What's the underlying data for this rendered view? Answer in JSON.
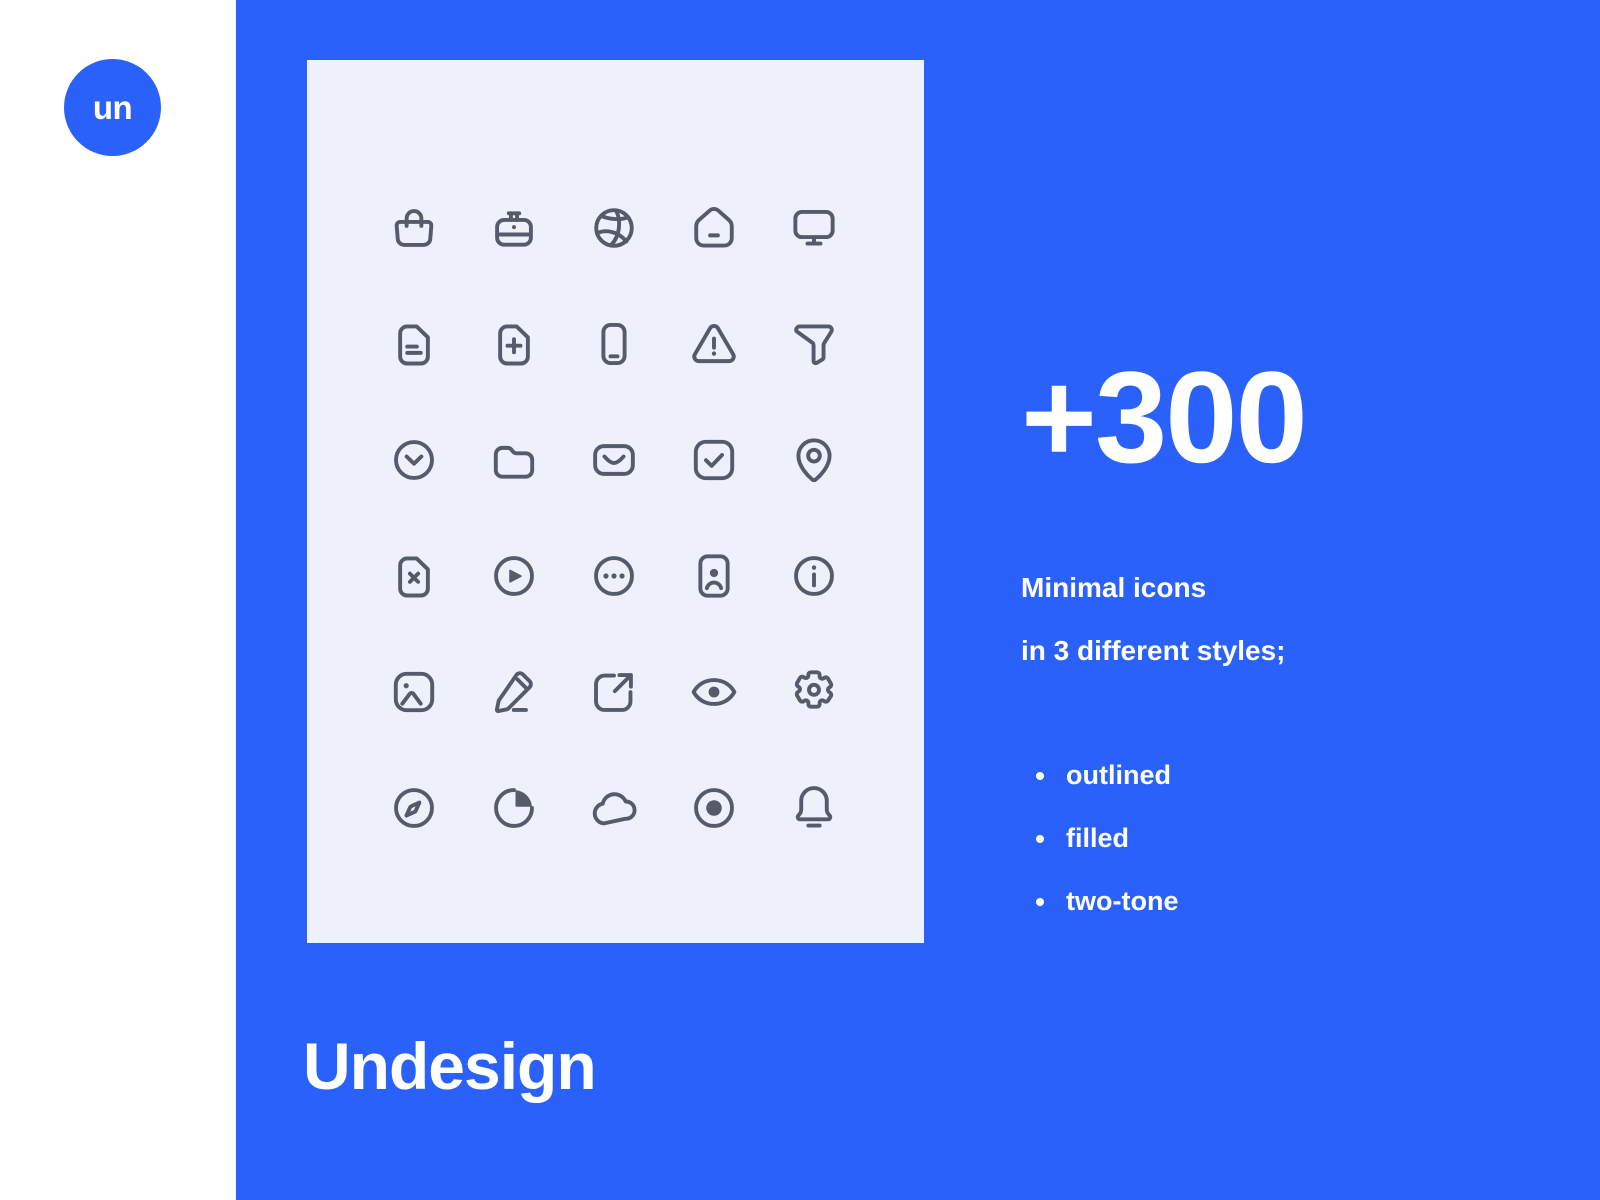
{
  "colors": {
    "brand_blue": "#2a61fb",
    "card_bg": "#eef0fb",
    "icon_stroke": "#555b6b",
    "text_on_blue": "#ffffff",
    "page_bg": "#ffffff"
  },
  "logo": {
    "text": "un"
  },
  "headline": {
    "count": "+300"
  },
  "description": {
    "line1": "Minimal icons",
    "line2": "in 3 different styles;"
  },
  "styles": [
    {
      "label": "outlined"
    },
    {
      "label": "filled"
    },
    {
      "label": "two-tone"
    }
  ],
  "brand": {
    "title": "Undesign"
  },
  "icon_grid": {
    "columns": 5,
    "rows": 6,
    "icons": [
      {
        "name": "shopping-bag-icon"
      },
      {
        "name": "briefcase-icon"
      },
      {
        "name": "globe-icon"
      },
      {
        "name": "home-icon"
      },
      {
        "name": "monitor-icon"
      },
      {
        "name": "file-text-icon"
      },
      {
        "name": "file-add-icon"
      },
      {
        "name": "mobile-phone-icon"
      },
      {
        "name": "alert-triangle-icon"
      },
      {
        "name": "filter-icon"
      },
      {
        "name": "chevron-down-circle-icon"
      },
      {
        "name": "folder-icon"
      },
      {
        "name": "envelope-icon"
      },
      {
        "name": "checkbox-check-icon"
      },
      {
        "name": "location-pin-icon"
      },
      {
        "name": "file-close-icon"
      },
      {
        "name": "play-circle-icon"
      },
      {
        "name": "more-horizontal-circle-icon"
      },
      {
        "name": "contact-card-icon"
      },
      {
        "name": "info-circle-icon"
      },
      {
        "name": "image-icon"
      },
      {
        "name": "pencil-edit-icon"
      },
      {
        "name": "external-link-icon"
      },
      {
        "name": "eye-icon"
      },
      {
        "name": "gear-settings-icon"
      },
      {
        "name": "compass-icon"
      },
      {
        "name": "pie-chart-icon"
      },
      {
        "name": "cloud-icon"
      },
      {
        "name": "record-dot-circle-icon"
      },
      {
        "name": "bell-notification-icon"
      }
    ]
  }
}
